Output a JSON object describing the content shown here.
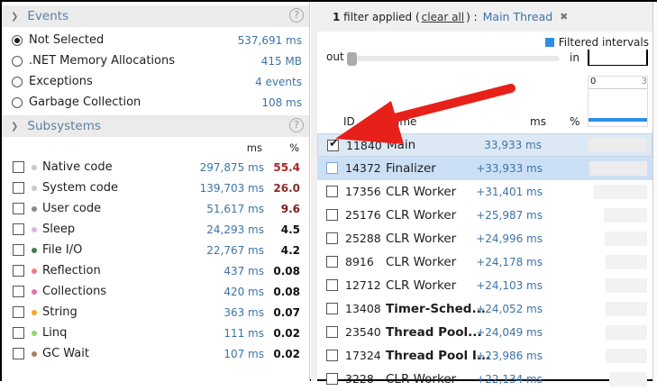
{
  "events": {
    "title": "Events",
    "help": "?",
    "items": [
      {
        "label": "Not Selected",
        "value": "537,691 ms",
        "selected": true
      },
      {
        "label": ".NET Memory Allocations",
        "value": "415 MB",
        "selected": false
      },
      {
        "label": "Exceptions",
        "value": "4 events",
        "selected": false
      },
      {
        "label": "Garbage Collection",
        "value": "108 ms",
        "selected": false
      }
    ]
  },
  "subsystems": {
    "title": "Subsystems",
    "help": "?",
    "col_ms": "ms",
    "col_pct": "%",
    "items": [
      {
        "label": "Native code",
        "ms": "297,875 ms",
        "pct": "55.4",
        "color": "#c8c8c8",
        "pct_color": "#a52a2a"
      },
      {
        "label": "System code",
        "ms": "139,703 ms",
        "pct": "26.0",
        "color": "#c8c8c8",
        "pct_color": "#8b2b2b"
      },
      {
        "label": "User code",
        "ms": "51,617 ms",
        "pct": "9.6",
        "color": "#8a8a8a",
        "pct_color": "#7a2020"
      },
      {
        "label": "Sleep",
        "ms": "24,293 ms",
        "pct": "4.5",
        "color": "#e0b0e8",
        "pct_color": "#111"
      },
      {
        "label": "File I/O",
        "ms": "22,767 ms",
        "pct": "4.2",
        "color": "#3d7a4f",
        "pct_color": "#111"
      },
      {
        "label": "Reflection",
        "ms": "437 ms",
        "pct": "0.08",
        "color": "#ee8080",
        "pct_color": "#111"
      },
      {
        "label": "Collections",
        "ms": "420 ms",
        "pct": "0.08",
        "color": "#e070b0",
        "pct_color": "#111"
      },
      {
        "label": "String",
        "ms": "363 ms",
        "pct": "0.07",
        "color": "#f5a623",
        "pct_color": "#111"
      },
      {
        "label": "Linq",
        "ms": "111 ms",
        "pct": "0.02",
        "color": "#90d870",
        "pct_color": "#111"
      },
      {
        "label": "GC Wait",
        "ms": "107 ms",
        "pct": "0.02",
        "color": "#a88060",
        "pct_color": "#111"
      }
    ]
  },
  "filter": {
    "count": "1",
    "text": " filter applied (",
    "clear": "clear all",
    "after": ") :",
    "tag": "Main Thread",
    "close": "✖"
  },
  "timeline": {
    "legend": "Filtered intervals",
    "out": "out",
    "in": "in",
    "mini_start": "0",
    "mini_end": "3",
    "legend_color": "#2e8ee8"
  },
  "threads": {
    "col_id": "ID",
    "col_name": "Name",
    "col_ms": "ms",
    "col_pct": "%",
    "rows": [
      {
        "id": "11840",
        "name": "Main",
        "ms": "33,933 ms",
        "checked": true,
        "bold": false,
        "bar": 0.95
      },
      {
        "id": "14372",
        "name": "Finalizer",
        "ms": "+33,933 ms",
        "checked": false,
        "bold": false,
        "bar": 0.95
      },
      {
        "id": "17356",
        "name": "CLR Worker",
        "ms": "+31,401 ms",
        "checked": false,
        "bold": false,
        "bar": 0.88
      },
      {
        "id": "25176",
        "name": "CLR Worker",
        "ms": "+25,987 ms",
        "checked": false,
        "bold": false,
        "bar": 0.72
      },
      {
        "id": "25288",
        "name": "CLR Worker",
        "ms": "+24,996 ms",
        "checked": false,
        "bold": false,
        "bar": 0.7
      },
      {
        "id": "8916",
        "name": "CLR Worker",
        "ms": "+24,178 ms",
        "checked": false,
        "bold": false,
        "bar": 0.68
      },
      {
        "id": "12712",
        "name": "CLR Worker",
        "ms": "+24,103 ms",
        "checked": false,
        "bold": false,
        "bar": 0.68
      },
      {
        "id": "13408",
        "name": "Timer-Sched...",
        "ms": "+24,052 ms",
        "checked": false,
        "bold": true,
        "bar": 0.68
      },
      {
        "id": "23540",
        "name": "Thread Pool...",
        "ms": "+24,049 ms",
        "checked": false,
        "bold": true,
        "bar": 0.68
      },
      {
        "id": "17324",
        "name": "Thread Pool I...",
        "ms": "+23,986 ms",
        "checked": false,
        "bold": true,
        "bar": 0.68
      },
      {
        "id": "3228",
        "name": "CLR Worker",
        "ms": "+22,134 ms",
        "checked": false,
        "bold": false,
        "bar": 0.62
      }
    ]
  }
}
